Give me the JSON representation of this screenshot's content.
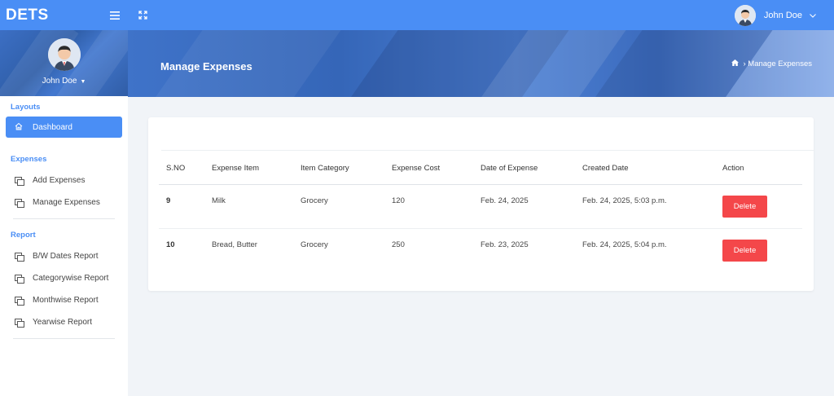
{
  "brand": "DETS",
  "topbar": {
    "user_name": "John Doe"
  },
  "sidebar": {
    "profile_name": "John Doe",
    "sections": {
      "layouts": "Layouts",
      "expenses": "Expenses",
      "report": "Report"
    },
    "items": {
      "dashboard": "Dashboard",
      "add_expenses": "Add Expenses",
      "manage_expenses": "Manage Expenses",
      "bw_dates": "B/W Dates Report",
      "categorywise": "Categorywise Report",
      "monthwise": "Monthwise Report",
      "yearwise": "Yearwise Report"
    }
  },
  "header": {
    "title": "Manage Expenses",
    "breadcrumb": "Manage Expenses"
  },
  "table": {
    "columns": [
      "S.NO",
      "Expense Item",
      "Item Category",
      "Expense Cost",
      "Date of Expense",
      "Created Date",
      "Action"
    ],
    "rows": [
      {
        "sno": "9",
        "item": "Milk",
        "category": "Grocery",
        "cost": "120",
        "date": "Feb. 24, 2025",
        "created": "Feb. 24, 2025, 5:03 p.m.",
        "action": "Delete"
      },
      {
        "sno": "10",
        "item": "Bread, Butter",
        "category": "Grocery",
        "cost": "250",
        "date": "Feb. 23, 2025",
        "created": "Feb. 24, 2025, 5:04 p.m.",
        "action": "Delete"
      }
    ]
  },
  "colors": {
    "primary": "#4a8ef5",
    "danger": "#f4474a",
    "banner": "#3f73c9"
  }
}
